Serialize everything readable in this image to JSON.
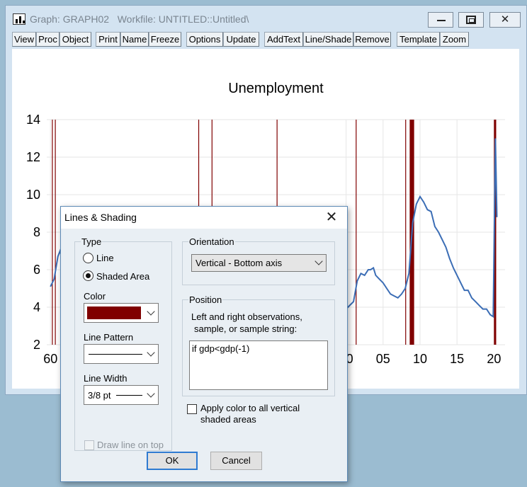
{
  "window": {
    "title": "Graph: GRAPH02   Workfile: UNTITLED::Untitled\\",
    "controls": {
      "close": "✕"
    }
  },
  "toolbar": {
    "buttons": [
      "View",
      "Proc",
      "Object",
      "Print",
      "Name",
      "Freeze",
      "Options",
      "Update",
      "AddText",
      "Line/Shade",
      "Remove",
      "Template",
      "Zoom"
    ]
  },
  "chart_data": {
    "type": "line",
    "title": "Unemployment",
    "xlabel": "",
    "ylabel": "",
    "ylim": [
      2,
      14
    ],
    "xlim": [
      1959.5,
      2021.5
    ],
    "yticks": [
      2,
      4,
      6,
      8,
      10,
      12,
      14
    ],
    "xticks": [
      {
        "value": 1960,
        "label": "60"
      },
      {
        "value": 2000,
        "label": "00"
      },
      {
        "value": 2005,
        "label": "05"
      },
      {
        "value": 2010,
        "label": "10"
      },
      {
        "value": 2015,
        "label": "15"
      },
      {
        "value": 2020,
        "label": "20"
      }
    ],
    "grid": true,
    "legend": "none",
    "line_color": "#3b6db5",
    "shade_color": "#800000",
    "shaded_periods": [
      [
        1960.2,
        1960.3
      ],
      [
        1960.6,
        1960.7
      ],
      [
        1980.0,
        1980.1
      ],
      [
        1981.8,
        1981.9
      ],
      [
        1990.6,
        1990.7
      ],
      [
        2001.3,
        2001.4
      ],
      [
        2008.0,
        2008.1
      ],
      [
        2008.6,
        2009.2
      ],
      [
        2020.0,
        2020.3
      ]
    ],
    "series": [
      {
        "x": [
          1960.0,
          1960.5,
          1961.0,
          1961.3,
          1961.6,
          1962.0,
          1980.0,
          1980.5,
          1981.0,
          1981.5,
          1982.0,
          1999.0,
          1999.5,
          2000.0,
          2001.0,
          2001.5,
          2002.0,
          2002.5,
          2003.0,
          2003.3,
          2003.7,
          2004.0,
          2004.5,
          2005.0,
          2005.5,
          2006.0,
          2006.5,
          2007.0,
          2007.5,
          2008.0,
          2008.5,
          2009.0,
          2009.5,
          2010.0,
          2010.5,
          2011.0,
          2011.5,
          2012.0,
          2012.5,
          2013.0,
          2013.5,
          2014.0,
          2014.5,
          2015.0,
          2015.5,
          2016.0,
          2016.5,
          2017.0,
          2017.5,
          2018.0,
          2018.5,
          2019.0,
          2019.5,
          2019.9,
          2020.2,
          2020.4
        ],
        "values": [
          5.1,
          5.5,
          6.7,
          7.0,
          6.5,
          5.6,
          6.3,
          7.7,
          7.5,
          7.5,
          8.6,
          4.3,
          4.1,
          3.9,
          4.3,
          5.4,
          5.8,
          5.7,
          6.0,
          6.0,
          6.1,
          5.7,
          5.5,
          5.3,
          5.0,
          4.7,
          4.6,
          4.5,
          4.7,
          5.0,
          5.8,
          8.5,
          9.5,
          9.9,
          9.6,
          9.2,
          9.1,
          8.3,
          8.0,
          7.6,
          7.2,
          6.6,
          6.1,
          5.7,
          5.3,
          4.9,
          4.9,
          4.5,
          4.3,
          4.1,
          3.9,
          3.9,
          3.6,
          3.5,
          13.0,
          8.8
        ]
      }
    ]
  },
  "dialog": {
    "title": "Lines & Shading",
    "close": "✕",
    "type": {
      "label": "Type",
      "line": "Line",
      "shaded": "Shaded Area"
    },
    "color": {
      "label": "Color",
      "value": "#800000"
    },
    "line_pattern": {
      "label": "Line Pattern"
    },
    "line_width": {
      "label": "Line Width",
      "value": "3/8 pt"
    },
    "draw_on_top": "Draw line on top",
    "orientation": {
      "label": "Orientation",
      "value": "Vertical - Bottom axis"
    },
    "position": {
      "label": "Position",
      "desc1": "Left and right observations,",
      "desc2": "sample, or sample string:",
      "value": "if gdp<gdp(-1)"
    },
    "apply_all_1": "Apply color to all vertical",
    "apply_all_2": "shaded areas",
    "ok": "OK",
    "cancel": "Cancel"
  }
}
